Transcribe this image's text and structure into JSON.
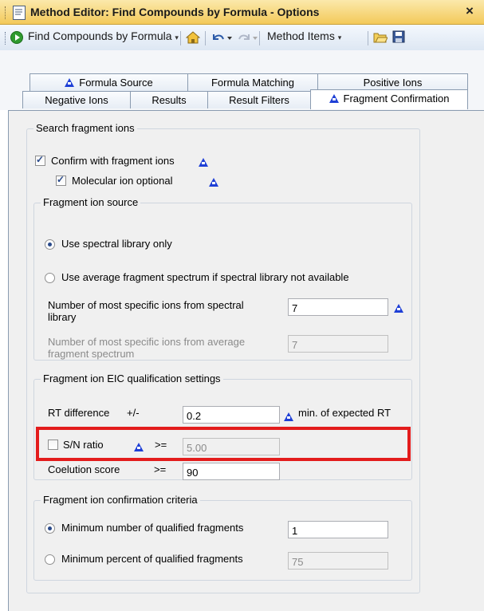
{
  "window": {
    "title": "Method Editor: Find Compounds by Formula - Options",
    "close_glyph": "×"
  },
  "toolbar": {
    "method_label": "Find Compounds by Formula",
    "items_label": "Method Items",
    "dropdown_glyph": "▾"
  },
  "tabs": {
    "row1": [
      "Formula Source",
      "Formula Matching",
      "Positive Ions"
    ],
    "row2": [
      "Negative Ions",
      "Results",
      "Result Filters",
      "Fragment Confirmation"
    ],
    "active": "Fragment Confirmation"
  },
  "search": {
    "title": "Search fragment ions",
    "confirm_label": "Confirm with fragment ions",
    "confirm_checked": true,
    "molecular_label": "Molecular ion optional",
    "molecular_checked": true
  },
  "source": {
    "title": "Fragment ion source",
    "opt1": "Use spectral library only",
    "opt2": "Use average fragment spectrum if spectral library not available",
    "selected": "opt1",
    "n_lib_label": "Number of most specific ions from spectral library",
    "n_lib_value": "7",
    "n_avg_label": "Number of most specific ions from average fragment spectrum",
    "n_avg_value": "7"
  },
  "eic": {
    "title": "Fragment ion EIC qualification settings",
    "rt_label": "RT difference",
    "rt_op": "+/-",
    "rt_value": "0.2",
    "rt_unit": "min. of expected RT",
    "sn_label": "S/N ratio",
    "sn_checked": false,
    "sn_op": ">=",
    "sn_value": "5.00",
    "coel_label": "Coelution score",
    "coel_op": ">=",
    "coel_value": "90"
  },
  "criteria": {
    "title": "Fragment ion confirmation criteria",
    "min_num_label": "Minimum number of qualified fragments",
    "min_num_value": "1",
    "min_pct_label": "Minimum percent of qualified fragments",
    "min_pct_value": "75",
    "selected": "min_num"
  },
  "colors": {
    "highlight": "#e31c1c",
    "info_icon": "#1e3fd6",
    "title_bar": "#f3c95a"
  },
  "icons": [
    "run-icon",
    "home-icon",
    "undo-icon",
    "redo-icon",
    "open-icon",
    "save-icon",
    "info-icon"
  ]
}
